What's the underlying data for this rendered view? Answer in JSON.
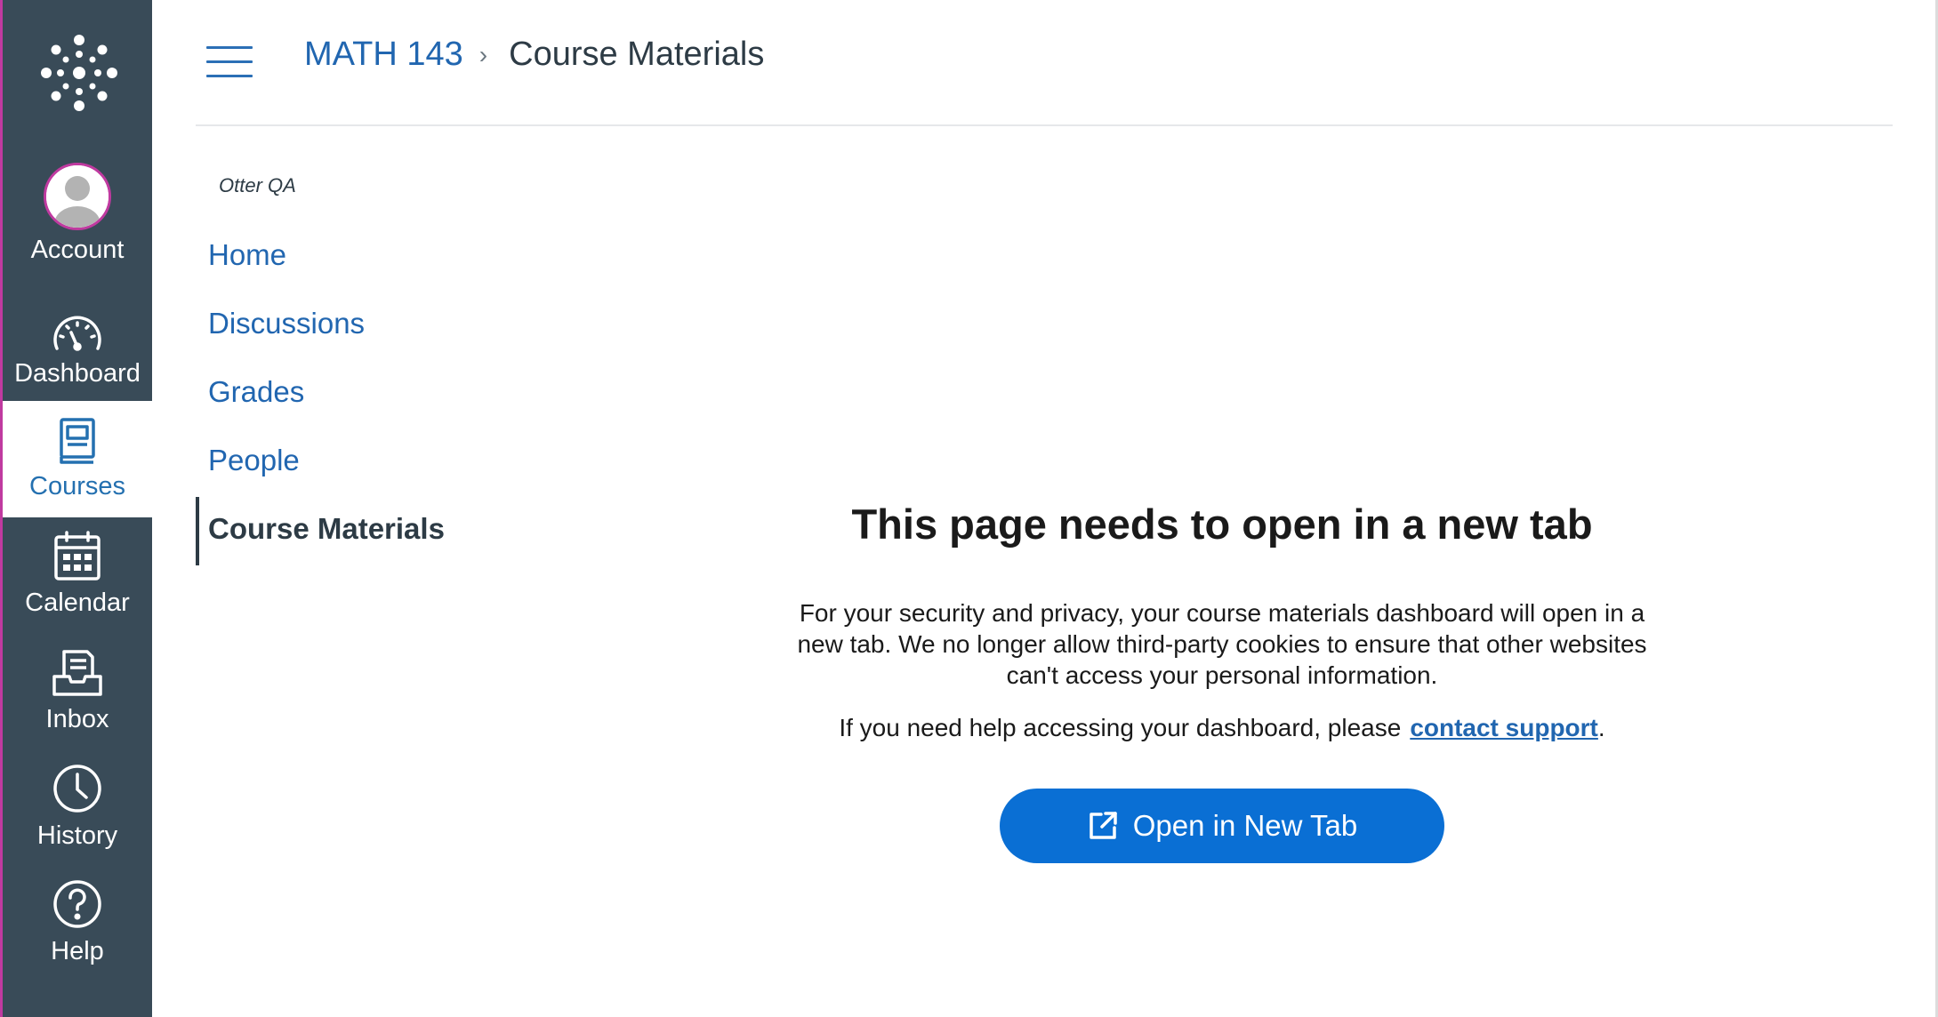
{
  "global_nav": {
    "items": [
      {
        "label": "Account",
        "icon": "avatar"
      },
      {
        "label": "Dashboard",
        "icon": "dashboard-icon"
      },
      {
        "label": "Courses",
        "icon": "courses-icon"
      },
      {
        "label": "Calendar",
        "icon": "calendar-icon"
      },
      {
        "label": "Inbox",
        "icon": "inbox-icon"
      },
      {
        "label": "History",
        "icon": "history-icon"
      },
      {
        "label": "Help",
        "icon": "help-icon"
      }
    ],
    "active": "Courses",
    "colors": {
      "background": "#394b58",
      "accent": "#c03aa0"
    }
  },
  "header": {
    "breadcrumb": {
      "course": "MATH 143",
      "current": "Course Materials"
    }
  },
  "course_nav": {
    "course_name": "Otter QA",
    "items": [
      {
        "label": "Home"
      },
      {
        "label": "Discussions"
      },
      {
        "label": "Grades"
      },
      {
        "label": "People"
      },
      {
        "label": "Course Materials"
      }
    ],
    "active": "Course Materials"
  },
  "main": {
    "title": "This page needs to open in a new tab",
    "description": "For your security and privacy, your course materials dashboard will open in a new tab. We no longer allow third-party cookies to ensure that other websites can't access your personal information.",
    "help_prefix": "If you need help accessing your dashboard, please",
    "help_link": "contact support",
    "help_suffix": ".",
    "button_label": "Open in New Tab",
    "button_color": "#0a6fd4"
  }
}
